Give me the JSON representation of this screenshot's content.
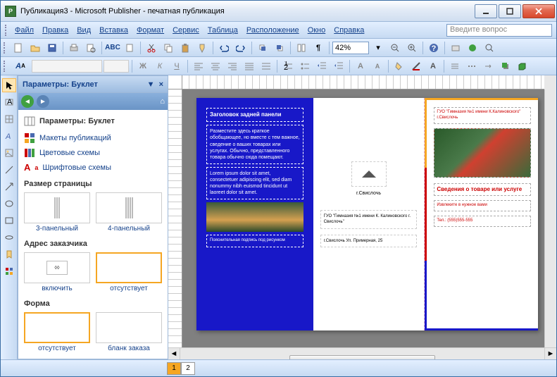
{
  "window": {
    "title": "Публикация3 - Microsoft Publisher - печатная публикация"
  },
  "menu": {
    "file": "Файл",
    "edit": "Правка",
    "view": "Вид",
    "insert": "Вставка",
    "format": "Формат",
    "service": "Сервис",
    "table": "Таблица",
    "arrange": "Расположение",
    "window": "Окно",
    "help": "Справка",
    "helpbox": "Введите вопрос"
  },
  "toolbar": {
    "zoom": "42%"
  },
  "taskpane": {
    "title": "Параметры: Буклет",
    "heading": "Параметры: Буклет",
    "links": {
      "layouts": "Макеты публикаций",
      "color": "Цветовые схемы",
      "font": "Шрифтовые схемы"
    },
    "sections": {
      "size": "Размер страницы",
      "addr": "Адрес заказчика",
      "form": "Форма"
    },
    "size": {
      "p3": "3-панельный",
      "p4": "4-панельный"
    },
    "addr": {
      "on": "включить",
      "off": "отсутствует"
    },
    "form": {
      "none": "отсутствует",
      "order": "бланк заказа"
    }
  },
  "doc": {
    "panel1": {
      "heading": "Заголовок задней панели",
      "body": "Разместите здесь краткое обобщающее, но вместе с тем важное, сведение о ваших товарах или услугах. Обычно, представленного товара обычно сюда помещают.",
      "lorem": "Lorem ipsum dolor sit amet, consectetuer adipiscing elit, sed diam nonummy nibh euismod tincidunt ut laoreet dolor sit amet.",
      "caption": "Пояснительная подпись под рисунком"
    },
    "panel2": {
      "org": "г.Свислочь",
      "addr1": "ГУО \"Гимназия №1 имени К. Калиновского г. Свислочь\"",
      "addr2": "г.Свислочь\nУл. Примерная, 25"
    },
    "panel3": {
      "org": "ГУО \"Гимназия №1 имени К.Калиновского\" г.Свислочь",
      "info": "Сведения о товаре или услуге",
      "promo": "Извлеките в нужное вами",
      "tel": "Тел.: (555)555-555"
    }
  },
  "pages": {
    "p1": "1",
    "p2": "2"
  }
}
